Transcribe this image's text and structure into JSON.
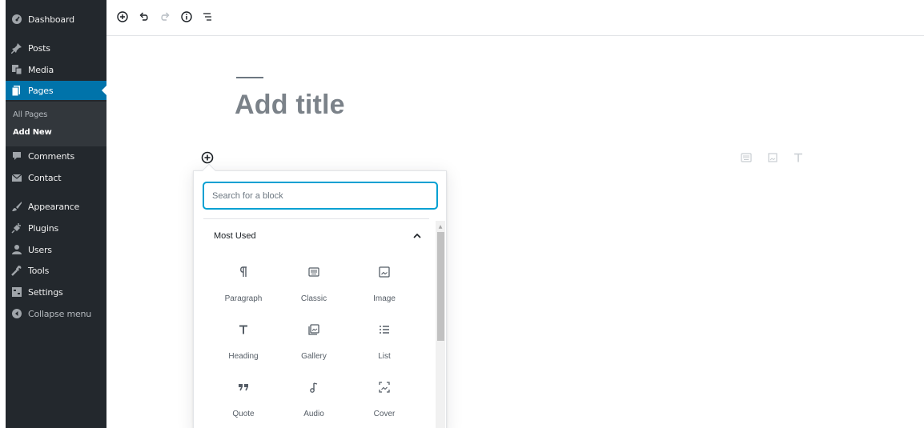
{
  "sidebar": {
    "menu": [
      {
        "label": "Dashboard",
        "icon": "dashboard-icon"
      },
      {
        "label": "Posts",
        "icon": "pin-icon"
      },
      {
        "label": "Media",
        "icon": "media-icon"
      },
      {
        "label": "Pages",
        "icon": "pages-icon",
        "current": true
      },
      {
        "label": "Comments",
        "icon": "comment-icon"
      },
      {
        "label": "Contact",
        "icon": "mail-icon"
      },
      {
        "label": "Appearance",
        "icon": "brush-icon"
      },
      {
        "label": "Plugins",
        "icon": "plugin-icon"
      },
      {
        "label": "Users",
        "icon": "users-icon"
      },
      {
        "label": "Tools",
        "icon": "wrench-icon"
      },
      {
        "label": "Settings",
        "icon": "settings-icon"
      },
      {
        "label": "Collapse menu",
        "icon": "collapse-icon"
      }
    ],
    "submenu": [
      {
        "label": "All Pages"
      },
      {
        "label": "Add New",
        "current": true
      }
    ]
  },
  "toolbar": {
    "icons": [
      "add-block-icon",
      "undo-icon",
      "redo-icon",
      "info-icon",
      "outline-icon"
    ]
  },
  "editor": {
    "title_placeholder": "Add title"
  },
  "inserter": {
    "search_placeholder": "Search for a block",
    "panel_title": "Most Used",
    "blocks": [
      {
        "label": "Paragraph",
        "icon": "paragraph-icon"
      },
      {
        "label": "Classic",
        "icon": "classic-icon"
      },
      {
        "label": "Image",
        "icon": "image-icon"
      },
      {
        "label": "Heading",
        "icon": "heading-icon"
      },
      {
        "label": "Gallery",
        "icon": "gallery-icon"
      },
      {
        "label": "List",
        "icon": "list-icon"
      },
      {
        "label": "Quote",
        "icon": "quote-icon"
      },
      {
        "label": "Audio",
        "icon": "audio-icon"
      },
      {
        "label": "Cover",
        "icon": "cover-icon"
      }
    ]
  },
  "colors": {
    "sidebar_bg": "#23282d",
    "accent": "#0073aa",
    "focus": "#00a0d2"
  }
}
